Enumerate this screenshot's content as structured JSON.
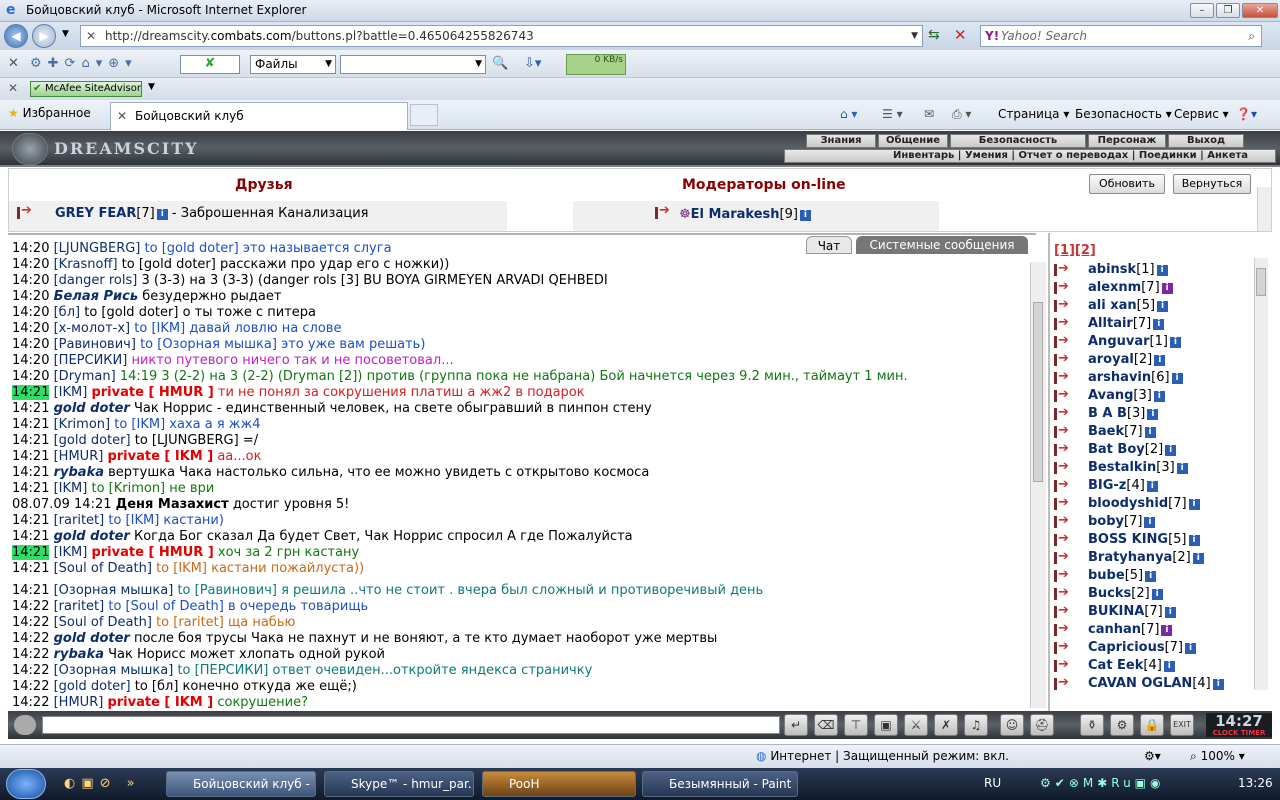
{
  "window": {
    "title": "Бойцовский клуб - Microsoft Internet Explorer"
  },
  "address": {
    "url_prefix": "http://dreamscity.",
    "url_domain": "combats.com",
    "url_suffix": "/buttons.pl?battle=0.465064255826743",
    "search_placeholder": "Yahoo! Search"
  },
  "toolbar": {
    "files_label": "Файлы",
    "speed": "0 KB/s",
    "mcafee": "McAfee SiteAdvisor"
  },
  "favbar": {
    "favorites": "Избранное",
    "tab_title": "Бойцовский клуб"
  },
  "commands": {
    "page": "Страница",
    "safety": "Безопасность",
    "service": "Сервис"
  },
  "game_menu": {
    "row1": [
      "Знания",
      "Общение",
      "Безопасность",
      "Персонаж",
      "Выход"
    ],
    "row2": "Инвентарь | Умения | Отчет о переводах | Поединки | Анкета",
    "logo": "DREAMSCITY"
  },
  "friends": {
    "title": "Друзья",
    "friend_name": "GREY FEAR",
    "friend_level": "[7]",
    "friend_location": "- Заброшенная Канализация",
    "moderators_title": "Модераторы on-line",
    "moderator_name": "El Marakesh",
    "moderator_level": "[9]",
    "refresh": "Обновить",
    "back": "Вернуться"
  },
  "chat_tabs": {
    "chat": "Чат",
    "system": "Системные сообщения"
  },
  "chat": [
    {
      "t": "14:20",
      "n": "[LJUNGBERG]",
      "to": "to [gold doter]",
      "m": "это называется слуга",
      "cls": "msg-blue",
      "nc": "nick"
    },
    {
      "t": "14:20",
      "n": "[Krasnoff]",
      "to": "to [gold doter]",
      "m": "расскажи про удар его с ножки))",
      "cls": "sys",
      "nc": "nick"
    },
    {
      "t": "14:20",
      "n": "[danger rols]",
      "to": "",
      "m": "3 (3-3) на 3 (3-3) (danger rols [3] BU BOYA GIRMEYEN ARVADI QEHBEDI",
      "cls": "sys",
      "nc": "nick"
    },
    {
      "t": "14:20",
      "n": "Белая Рись",
      "to": "",
      "m": "безудержно рыдает",
      "cls": "sys",
      "nc": "emote"
    },
    {
      "t": "14:20",
      "n": "[бл]",
      "to": "to [gold doter]",
      "m": "о ты тоже с питера",
      "cls": "sys",
      "nc": "nick"
    },
    {
      "t": "14:20",
      "n": "[х-молот-х]",
      "to": "to [IKM]",
      "m": "давай ловлю на слове",
      "cls": "msg-blue",
      "nc": "nick"
    },
    {
      "t": "14:20",
      "n": "[Равинович]",
      "to": "to [Озорная мышка]",
      "m": "это уже вам решать)",
      "cls": "msg-blue",
      "nc": "nick"
    },
    {
      "t": "14:20",
      "n": "[ПЕРСИКИ]",
      "to": "",
      "m": "никто путевого ничего так и не посоветовал...",
      "cls": "msg-mag",
      "nc": "nick"
    },
    {
      "t": "14:20",
      "n": "[Dryman]",
      "to": "",
      "m": "14:19 3 (2-2) на 3 (2-2) (Dryman [2]) против (группа пока не набрана) Бой начнется через 9.2 мин., таймаут 1 мин.",
      "cls": "msg-green",
      "nc": "nick"
    },
    {
      "t": "14:21",
      "n": "[IKM]",
      "to": "private [ HMUR ]",
      "m": "ти не понял за сокрушения платиш а жж2 в подарок",
      "cls": "msg-red",
      "nc": "nick",
      "hl": true,
      "priv": true
    },
    {
      "t": "14:21",
      "n": "gold doter",
      "to": "",
      "m": "Чак Норрис - единственный человек, на свете обыгравший в пинпон стену",
      "cls": "sys",
      "nc": "emote"
    },
    {
      "t": "14:21",
      "n": "[Krimon]",
      "to": "to [IKM]",
      "m": "хаха а я жж4",
      "cls": "msg-blue",
      "nc": "nick"
    },
    {
      "t": "14:21",
      "n": "[gold doter]",
      "to": "to [LJUNGBERG]",
      "m": "=/",
      "cls": "sys",
      "nc": "nick"
    },
    {
      "t": "14:21",
      "n": "[HMUR]",
      "to": "private [ IKM ]",
      "m": "аа...ок",
      "cls": "msg-red",
      "nc": "nick",
      "priv": true
    },
    {
      "t": "14:21",
      "n": "rybaka",
      "to": "",
      "m": "вертушка Чака настолько сильна, что ее можно увидеть с открытово космоса",
      "cls": "sys",
      "nc": "emote"
    },
    {
      "t": "14:21",
      "n": "[IKM]",
      "to": "to [Krimon]",
      "m": "не ври",
      "cls": "msg-green",
      "nc": "nick"
    },
    {
      "t": "08.07.09 14:21",
      "n": "Деня Мазахист",
      "to": "",
      "m": "достиг уровня 5!",
      "cls": "sys",
      "nc": "bold-black"
    },
    {
      "t": "14:21",
      "n": "[raritet]",
      "to": "to [IKM]",
      "m": "кастани)",
      "cls": "msg-blue",
      "nc": "nick"
    },
    {
      "t": "14:21",
      "n": "gold doter",
      "to": "",
      "m": "Когда Бог сказал Да будет Свет, Чак Норрис спросил А где Пожалуйста",
      "cls": "sys",
      "nc": "emote"
    },
    {
      "t": "14:21",
      "n": "[IKM]",
      "to": "private [ HMUR ]",
      "m": "хоч за 2 грн кастану",
      "cls": "msg-green",
      "nc": "nick",
      "hl": true,
      "priv": true
    },
    {
      "t": "14:21",
      "n": "[Soul of Death]",
      "to": "to [IKM]",
      "m": "кастани пожайлуста))",
      "cls": "msg-or",
      "nc": "nick"
    },
    {
      "t": "14:21",
      "n": "[Озорная мышка]",
      "to": "to [Равинович]",
      "m": "я решила ..что не стоит . вчера был сложный и противоречивый день",
      "cls": "msg-teal",
      "nc": "nick",
      "gap": true
    },
    {
      "t": "14:22",
      "n": "[raritet]",
      "to": "to [Soul of Death]",
      "m": "в очередь товарищь",
      "cls": "msg-blue",
      "nc": "nick"
    },
    {
      "t": "14:22",
      "n": "[Soul of Death]",
      "to": "to [raritet]",
      "m": "ща набью",
      "cls": "msg-or",
      "nc": "nick"
    },
    {
      "t": "14:22",
      "n": "gold doter",
      "to": "",
      "m": "после боя трусы Чака не пахнут и не воняют, а те кто думает наоборот уже мертвы",
      "cls": "sys",
      "nc": "emote"
    },
    {
      "t": "14:22",
      "n": "rybaka",
      "to": "",
      "m": "Чак Норисс может хлопать одной рукой",
      "cls": "sys",
      "nc": "emote"
    },
    {
      "t": "14:22",
      "n": "[Озорная мышка]",
      "to": "to [ПЕРСИКИ]",
      "m": "ответ очевиден...откройте яндекса страничку",
      "cls": "msg-teal",
      "nc": "nick"
    },
    {
      "t": "14:22",
      "n": "[gold doter]",
      "to": "to [бл]",
      "m": "конечно откуда же ещё;)",
      "cls": "sys",
      "nc": "nick"
    },
    {
      "t": "14:22",
      "n": "[HMUR]",
      "to": "private [ IKM ]",
      "m": "сокрушение?",
      "cls": "msg-green",
      "nc": "nick",
      "priv": true
    }
  ],
  "online": {
    "pages": "[1][2]",
    "users": [
      {
        "n": "abinsk",
        "l": "[1]"
      },
      {
        "n": "alexnm",
        "l": "[7]",
        "p": true
      },
      {
        "n": "ali xan",
        "l": "[5]"
      },
      {
        "n": "Alltair",
        "l": "[7]"
      },
      {
        "n": "Anguvar",
        "l": "[1]"
      },
      {
        "n": "aroyal",
        "l": "[2]"
      },
      {
        "n": "arshavin",
        "l": "[6]"
      },
      {
        "n": "Avang",
        "l": "[3]"
      },
      {
        "n": "B A B",
        "l": "[3]"
      },
      {
        "n": "Baek",
        "l": "[7]"
      },
      {
        "n": "Bat Boy",
        "l": "[2]"
      },
      {
        "n": "Bestalkin",
        "l": "[3]"
      },
      {
        "n": "BIG-z",
        "l": "[4]"
      },
      {
        "n": "bloodyshid",
        "l": "[7]"
      },
      {
        "n": "boby",
        "l": "[7]"
      },
      {
        "n": "BOSS KING",
        "l": "[5]"
      },
      {
        "n": "Bratyhanya",
        "l": "[2]"
      },
      {
        "n": "bube",
        "l": "[5]"
      },
      {
        "n": "Bucks",
        "l": "[2]"
      },
      {
        "n": "BUKINA",
        "l": "[7]"
      },
      {
        "n": "canhan",
        "l": "[7]",
        "p": true
      },
      {
        "n": "Capricious",
        "l": "[7]"
      },
      {
        "n": "Cat Eek",
        "l": "[4]"
      },
      {
        "n": "CAVAN OGLAN",
        "l": "[4]"
      }
    ]
  },
  "clock": {
    "time": "14:27",
    "label": "CLOCK TIMER"
  },
  "status": {
    "zone": "Интернет | Защищенный режим: вкл.",
    "zoom": "100%"
  },
  "taskbar": {
    "items": [
      "Бойцовский клуб - ...",
      "Skype™ - hmur_par...",
      "PooH",
      "Безымянный - Paint"
    ],
    "lang": "RU",
    "time": "13:26"
  }
}
